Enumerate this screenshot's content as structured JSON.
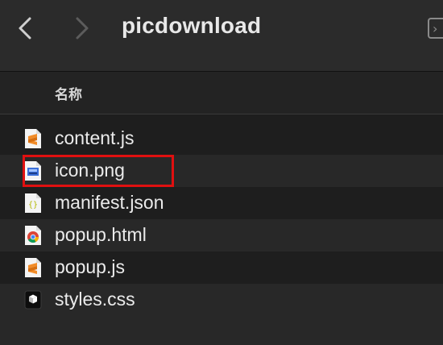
{
  "window": {
    "title": "picdownload"
  },
  "toolbar": {
    "back_icon": "chevron-left-icon",
    "forward_icon": "chevron-right-icon"
  },
  "list_header": {
    "name_column": "名称"
  },
  "files": [
    {
      "name": "content.js",
      "icon": "sublime-file-icon"
    },
    {
      "name": "icon.png",
      "icon": "image-file-icon",
      "highlighted": true
    },
    {
      "name": "manifest.json",
      "icon": "json-file-icon"
    },
    {
      "name": "popup.html",
      "icon": "chrome-file-icon"
    },
    {
      "name": "popup.js",
      "icon": "sublime-file-icon"
    },
    {
      "name": "styles.css",
      "icon": "css-file-icon"
    }
  ],
  "colors": {
    "highlight": "#e01010",
    "sublime": "#f28c28",
    "json": "#c9d100"
  }
}
